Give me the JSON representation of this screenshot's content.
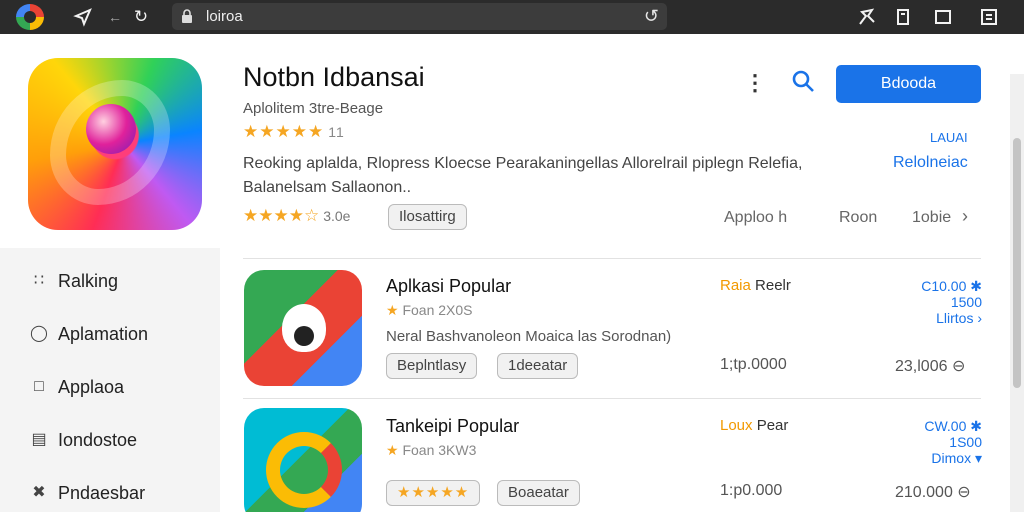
{
  "browser": {
    "url": "loiroa",
    "icons": [
      "google-logo",
      "share-icon",
      "back-icon",
      "reload-icon",
      "lock-icon",
      "extensions-icon",
      "bookmark-icon",
      "window-icon",
      "save-icon"
    ]
  },
  "app": {
    "title": "Notbn Idbansai",
    "subtitle": "Aplolitem 3tre-Beage",
    "stars": "★★★★★",
    "rating_count": "11",
    "description": "Reoking aplalda, Rlopress Kloecse Pearakaningellas Allorelrail piplegn Relefia, Balanelsam Sallaonon..",
    "stars2": "★★★★☆",
    "rating_value": "3.0e",
    "tag": "Ilosattirg",
    "meta": [
      "Apploo h",
      "Roon",
      "1obie"
    ],
    "primary_button": "Bdooda",
    "link_small": "LAUAI",
    "link_large": "Relolneiac"
  },
  "nav": {
    "items": [
      {
        "icon": "grid-icon",
        "label": "Ralking"
      },
      {
        "icon": "user-icon",
        "label": "Aplamation"
      },
      {
        "icon": "apps-icon",
        "label": "Applaoa"
      },
      {
        "icon": "library-icon",
        "label": "Iondostoe"
      },
      {
        "icon": "tools-icon",
        "label": "Pndaesbar"
      }
    ]
  },
  "list": [
    {
      "title": "Aplkasi Popular",
      "sub_star": "★",
      "sub": "Foan 2X0S",
      "desc": "Neral Bashvanoleon Moaica las Sorodnan)",
      "tags": [
        "Beplntlasy",
        "1deeatar"
      ],
      "rank_hl": "Raia",
      "rank": "Reelr",
      "stat": [
        "C10.00 ✱",
        "1500",
        "Llirtos ›"
      ],
      "price": "1;tp.0000",
      "price2": "23,l006 ⊖"
    },
    {
      "title": "Tankeipi Popular",
      "sub_star": "★",
      "sub": "Foan 3KW3",
      "desc": "",
      "tags": [
        "★★★★★",
        "Boaeatar"
      ],
      "rank_hl": "Loux",
      "rank": "Pear",
      "stat": [
        "CW.00 ✱",
        "1S00",
        "Dimox ▾"
      ],
      "price": "1:p0.000",
      "price2": "210.000 ⊖"
    }
  ]
}
